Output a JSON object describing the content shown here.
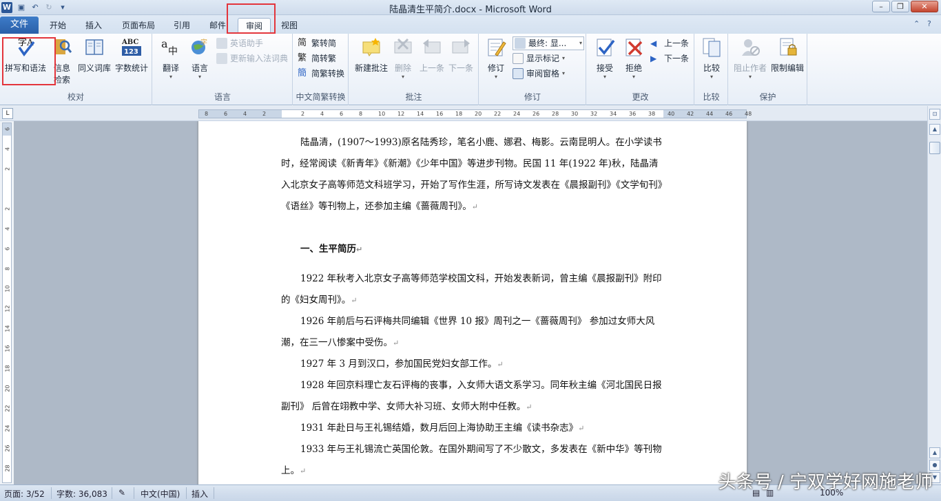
{
  "window": {
    "title": "陆晶清生平简介.docx - Microsoft Word",
    "app_icon": "W"
  },
  "tabs": {
    "file": "文件",
    "items": [
      "开始",
      "插入",
      "页面布局",
      "引用",
      "邮件",
      "审阅",
      "视图"
    ],
    "active": "审阅"
  },
  "ribbon": {
    "proofing": {
      "label": "校对",
      "spelling": "拼写和语法",
      "research_1": "信息",
      "research_2": "检索",
      "thesaurus": "同义词库",
      "wordcount": "字数统计"
    },
    "language": {
      "label": "语言",
      "translate": "翻译",
      "language": "语言",
      "english_assist": "英语助手",
      "update_ime": "更新输入法词典"
    },
    "chinese": {
      "label": "中文简繁转换",
      "to_simplified": "繁转简",
      "to_traditional": "简转繁",
      "convert": "简繁转换"
    },
    "comments": {
      "label": "批注",
      "new": "新建批注",
      "delete": "删除",
      "previous": "上一条",
      "next": "下一条"
    },
    "tracking": {
      "label": "修订",
      "track": "修订",
      "final_select": "最终: 显...",
      "show_markup": "显示标记",
      "review_pane": "审阅窗格"
    },
    "changes": {
      "label": "更改",
      "accept": "接受",
      "reject": "拒绝",
      "previous": "上一条",
      "next": "下一条"
    },
    "compare": {
      "label": "比较",
      "compare": "比较"
    },
    "protect": {
      "label": "保护",
      "block_authors": "阻止作者",
      "restrict": "限制编辑"
    }
  },
  "ruler": {
    "h_ticks": [
      "8",
      "6",
      "4",
      "2",
      "",
      "2",
      "4",
      "6",
      "8",
      "10",
      "12",
      "14",
      "16",
      "18",
      "20",
      "22",
      "24",
      "26",
      "28",
      "30",
      "32",
      "34",
      "36",
      "38",
      "40",
      "42",
      "44",
      "46",
      "48"
    ],
    "v_ticks": [
      "6",
      "4",
      "2",
      "",
      "2",
      "4",
      "6",
      "8",
      "10",
      "12",
      "14",
      "16",
      "18",
      "20",
      "22",
      "24",
      "26",
      "28"
    ]
  },
  "document": {
    "p1": "陆晶清，(1907～1993)原名陆秀珍，笔名小鹿、娜君、梅影。云南昆明人。在小学读书时，经常阅读《新青年》《新潮》《少年中国》等进步刊物。民国 11 年(1922 年)秋，陆晶清入北京女子高等师范文科班学习，开始了写作生涯，所写诗文发表在《晨报副刊》《文学旬刊》《语丝》等刊物上，还参加主编《蔷薇周刊》。",
    "heading": "一、生平简历",
    "p2": "1922 年秋考入北京女子高等师范学校国文科，开始发表新词，曾主编《晨报副刊》附印的《妇女周刊》。",
    "p3": "1926 年前后与石评梅共同编辑《世界 10 报》周刊之一《蔷薇周刊》 参加过女师大风潮，在三一八惨案中受伤。",
    "p4": "1927 年 3 月到汉口，参加国民党妇女部工作。",
    "p5": "1928 年回京料理亡友石评梅的丧事，入女师大语文系学习。同年秋主编《河北国民日报副刊》 后曾在翊教中学、女师大补习班、女师大附中任教。",
    "p6": "1931 年赴日与王礼锡结婚，数月后回上海协助王主编《读书杂志》",
    "p7": "1933 年与王礼锡流亡英国伦敦。在国外期间写了不少散文，多发表在《新中华》等刊物上。",
    "para_mark": "↵"
  },
  "status": {
    "page": "页面: 3/52",
    "words": "字数: 36,083",
    "lang": "中文(中国)",
    "mode": "插入",
    "zoom": "100%"
  },
  "watermark": "头条号 / 宁双学好网施老师"
}
